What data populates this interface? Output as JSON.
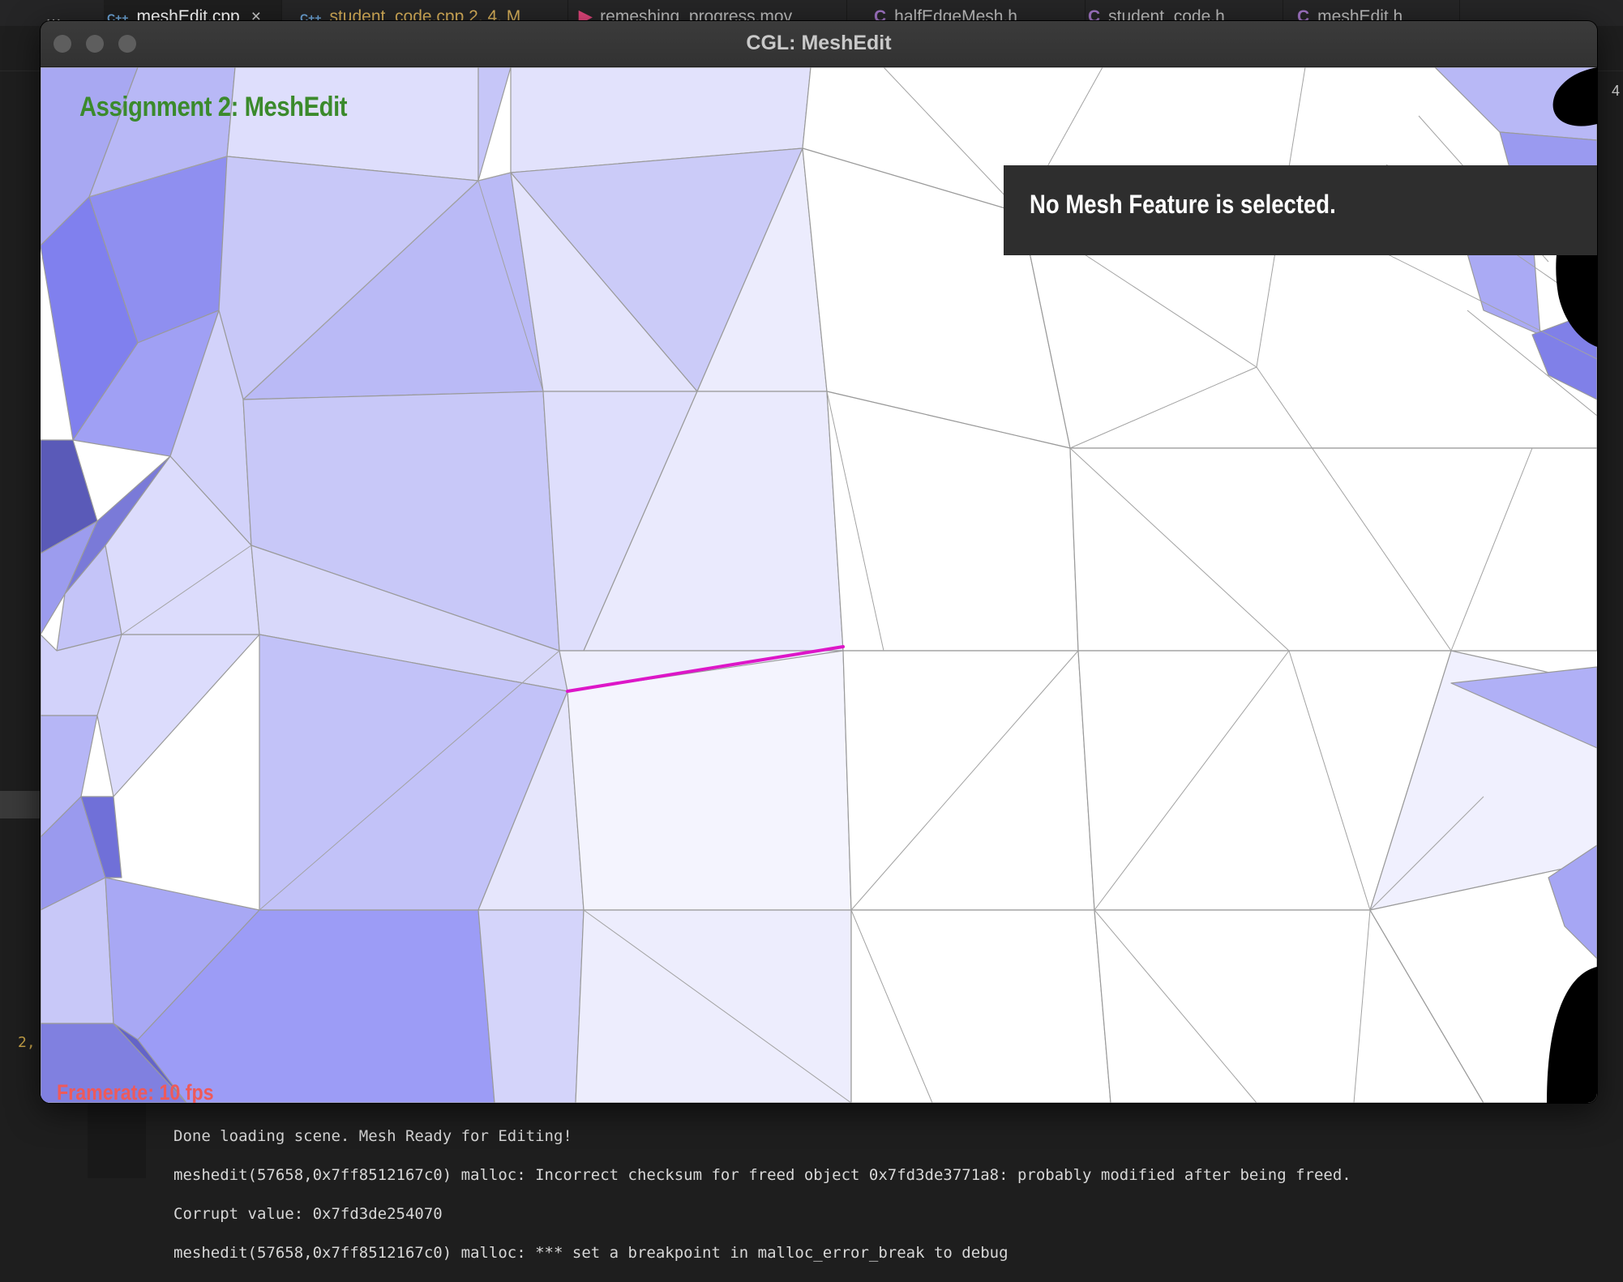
{
  "editor": {
    "tabs": [
      {
        "icon": "C++",
        "label": "meshEdit.cpp",
        "active": true,
        "close": "×"
      },
      {
        "icon": "C++",
        "label": "student_code.cpp 2, 4, M",
        "modified": true
      },
      {
        "icon": "▶",
        "label": "remeshing_progress.mov"
      },
      {
        "icon": "C",
        "label": "halfEdgeMesh.h"
      },
      {
        "icon": "C",
        "label": "student_code.h"
      },
      {
        "icon": "C",
        "label": "meshEdit.h"
      }
    ],
    "more_label": "…",
    "gutter_line": "2,",
    "right_number": "4"
  },
  "window": {
    "title": "CGL: MeshEdit"
  },
  "viewport": {
    "heading": "Assignment 2: MeshEdit",
    "status_message": "No Mesh Feature is selected.",
    "framerate": "Framerate: 10 fps",
    "selected_edge_color": "#dd16c8",
    "heading_color": "#3b8a2c",
    "framerate_color": "#ee5a5a"
  },
  "terminal": {
    "lines": [
      "Done loading scene. Mesh Ready for Editing!",
      "meshedit(57658,0x7ff8512167c0) malloc: Incorrect checksum for freed object 0x7fd3de3771a8: probably modified after being freed.",
      "Corrupt value: 0x7fd3de254070",
      "meshedit(57658,0x7ff8512167c0) malloc: *** set a breakpoint in malloc_error_break to debug"
    ]
  }
}
